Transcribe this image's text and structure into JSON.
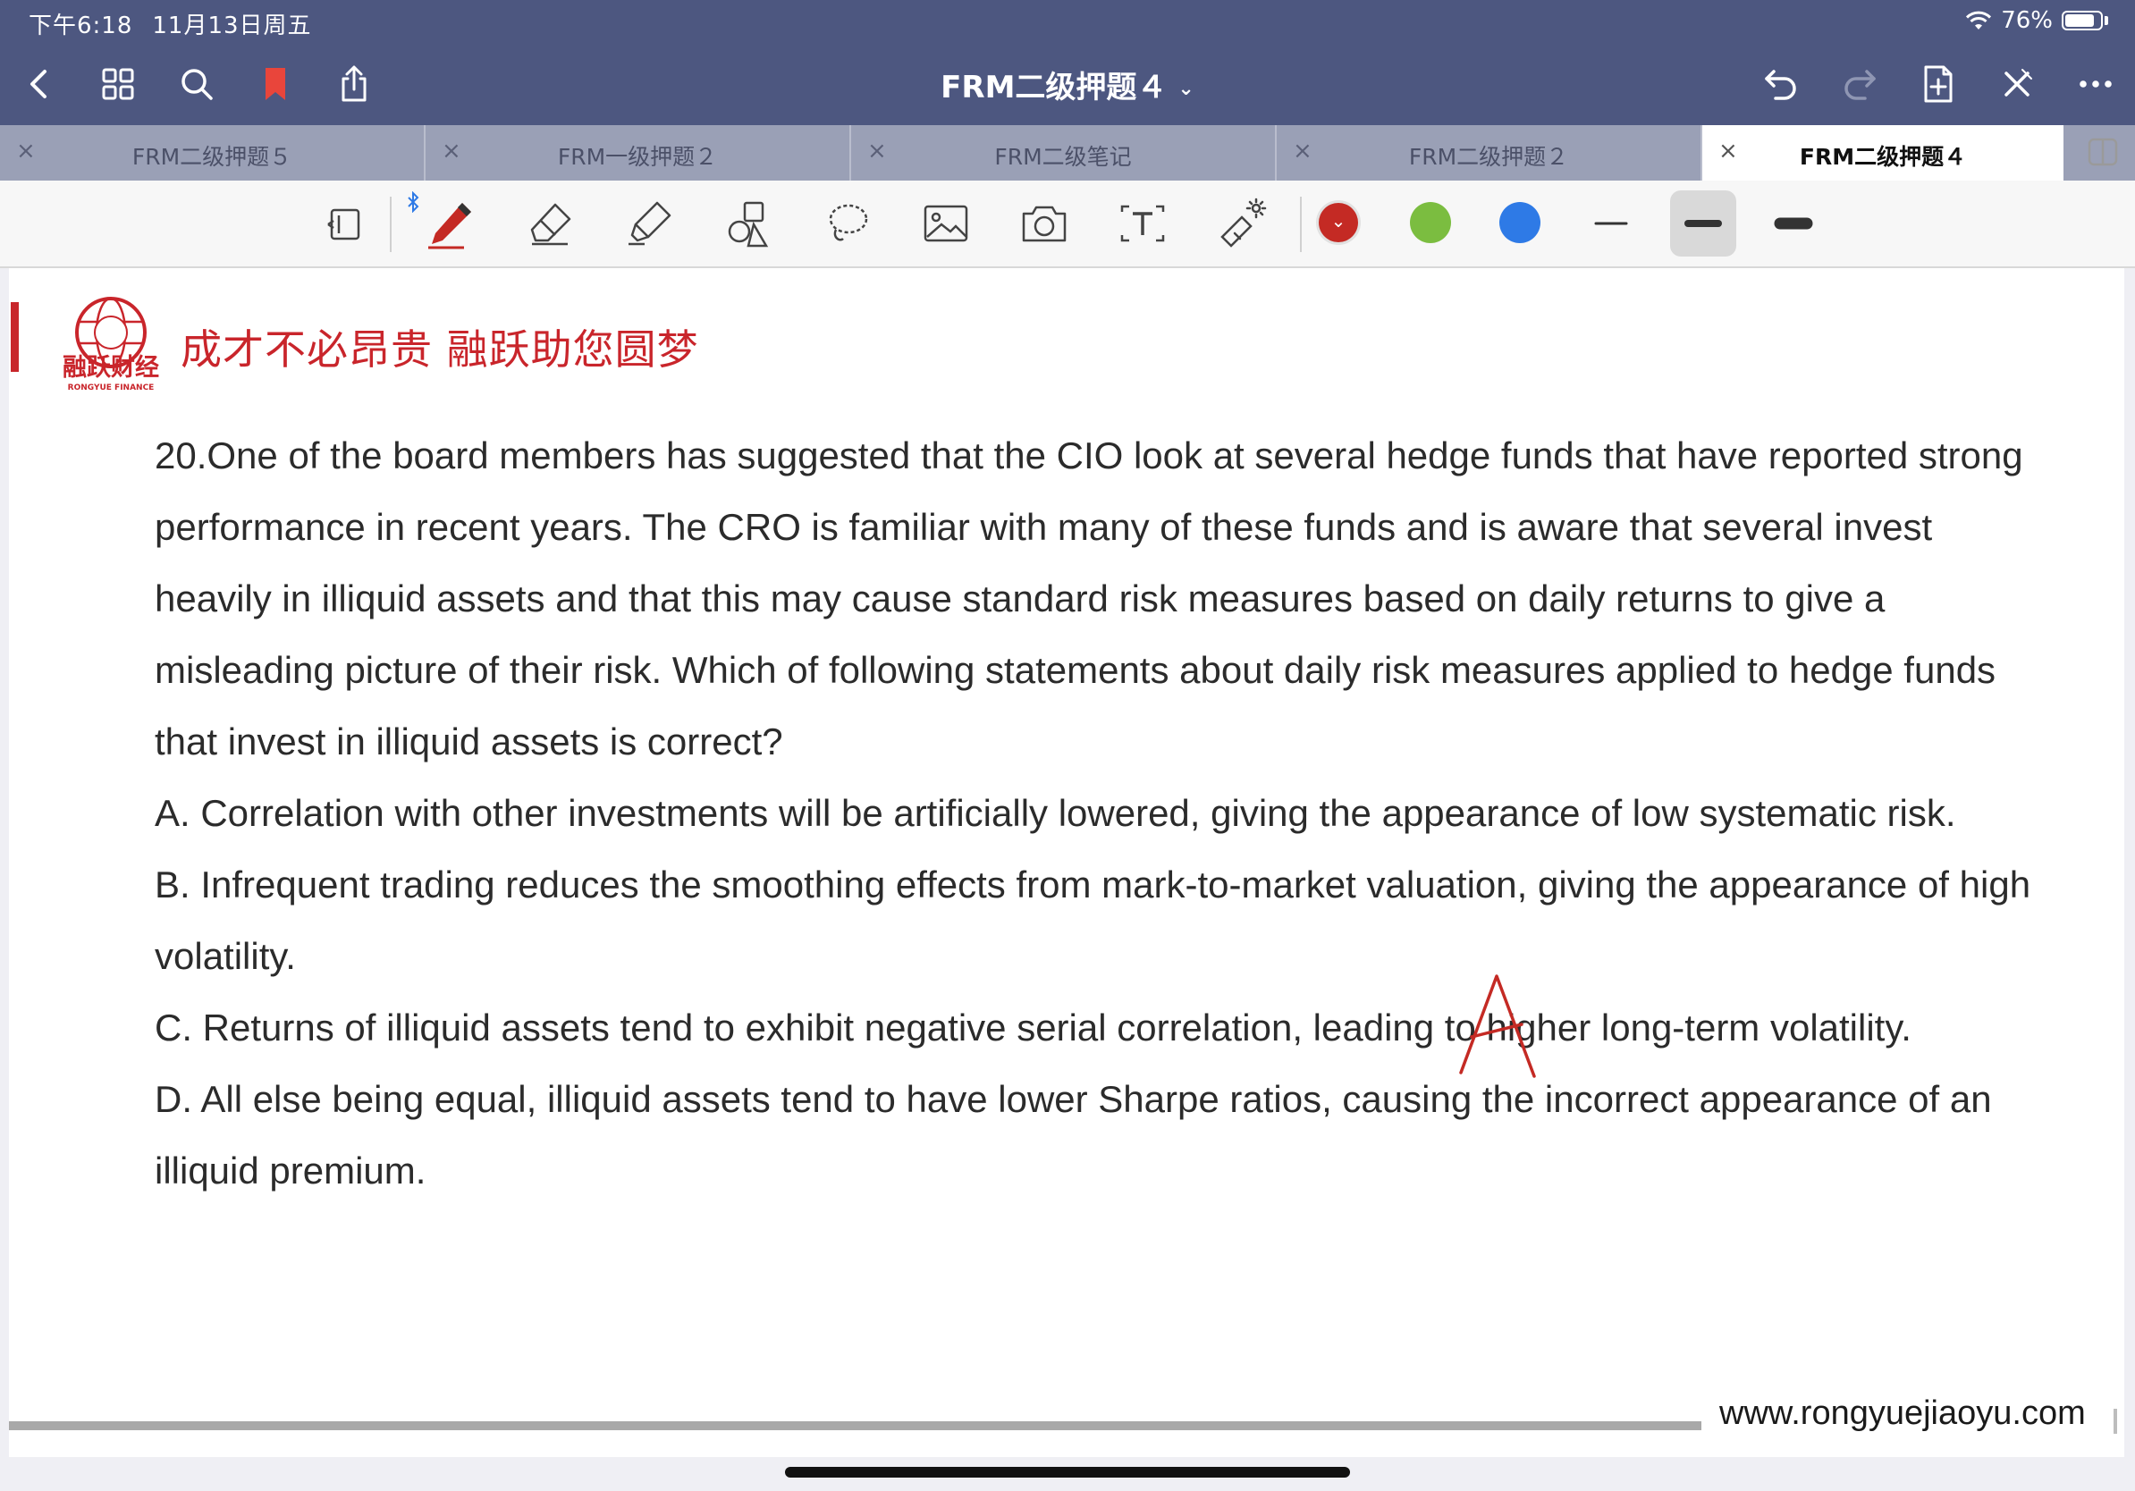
{
  "status": {
    "time": "下午6:18",
    "date": "11月13日周五",
    "battery": "76%"
  },
  "nav": {
    "title": "FRM二级押题４"
  },
  "tabs": [
    {
      "label": "FRM二级押题５",
      "active": false
    },
    {
      "label": "FRM一级押题２",
      "active": false
    },
    {
      "label": "FRM二级笔记",
      "active": false
    },
    {
      "label": "FRM二级押题２",
      "active": false
    },
    {
      "label": "FRM二级押题４",
      "active": true
    }
  ],
  "tab_close_glyph": "×",
  "toolbar": {
    "colors": [
      "#c42a24",
      "#7bbd40",
      "#2e7ae6"
    ],
    "selected_color": "#c42a24",
    "icons": [
      "page-layout-icon",
      "bluetooth-icon",
      "pen-icon",
      "eraser-icon",
      "highlighter-icon",
      "shapes-icon",
      "lasso-icon",
      "image-icon",
      "camera-icon",
      "text-icon",
      "laser-pointer-icon"
    ]
  },
  "document": {
    "slogan": "成才不必昂贵 融跃助您圆梦",
    "logo_text": "融跃财经",
    "logo_sub": "RONGYUE FINANCE",
    "question": "20.One of the board members has suggested that the CIO look at several hedge funds that have reported strong performance in recent years. The CRO is familiar with many of these funds and is aware that several invest heavily in illiquid assets and that this may cause standard risk measures based on daily returns to give a misleading picture of their risk. Which of following statements about daily risk measures applied to hedge funds that invest in illiquid assets is correct?",
    "options": [
      "A. Correlation with other investments will be artificially lowered, giving the appearance of low systematic risk.",
      "B. Infrequent trading reduces the smoothing effects from mark-to-market valuation, giving the appearance of high volatility.",
      "C. Returns of illiquid assets tend to exhibit negative serial correlation, leading to higher long-term volatility.",
      "D. All else being equal, illiquid assets tend to have lower Sharpe ratios, causing the incorrect appearance of an illiquid premium."
    ],
    "handwritten_answer": "A",
    "footer_url": "www.rongyuejiaoyu.com"
  }
}
